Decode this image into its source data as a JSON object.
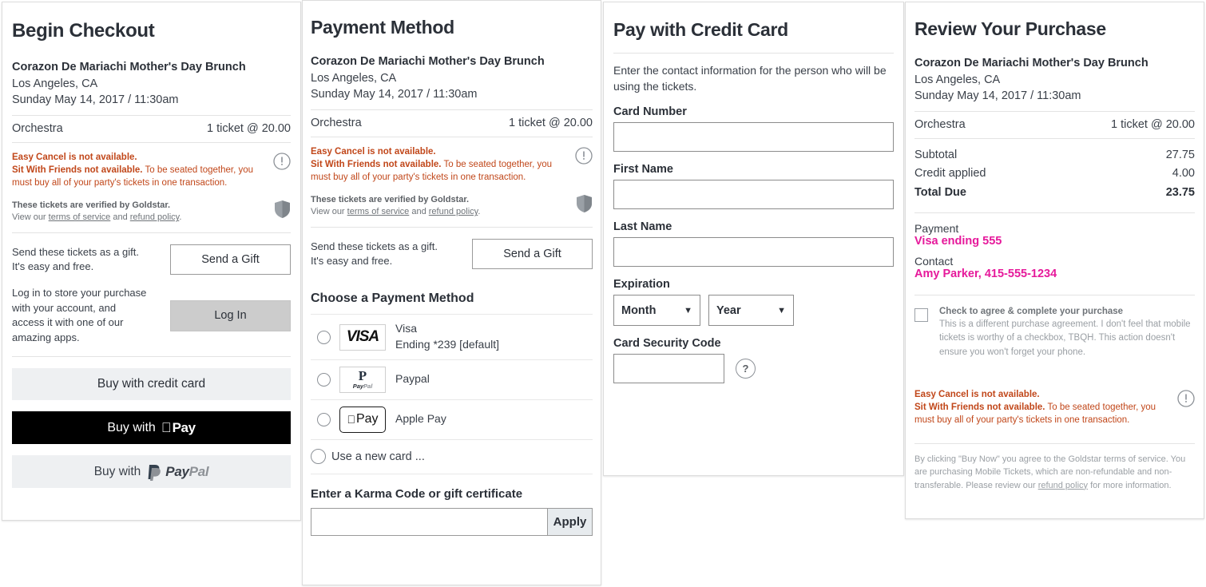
{
  "event": {
    "name": "Corazon De Mariachi Mother's Day Brunch",
    "location": "Los Angeles, CA",
    "datetime": "Sunday May 14, 2017 / 11:30am",
    "section": "Orchestra",
    "quantity_price": "1 ticket @ 20.00"
  },
  "alert": {
    "line1": "Easy Cancel is not available.",
    "line2_bold": "Sit With Friends not available.",
    "line2_rest": " To be seated together, you must buy all of your party's tickets in one transaction.",
    "icon": "warning-icon",
    "color": "#c1471a"
  },
  "verified": {
    "headline": "These tickets are verified by Goldstar.",
    "prefix": "View our ",
    "terms_link": "terms of service",
    "middle": " and ",
    "refund_link": "refund policy",
    "suffix": ".",
    "icon": "shield-icon"
  },
  "panel1": {
    "title": "Begin Checkout",
    "gift_text": "Send these tickets as a gift. It's easy and free.",
    "gift_button": "Send a Gift",
    "login_text": "Log in to store your purchase with your account, and access it with one of our amazing apps.",
    "login_button": "Log In",
    "buy_credit_card": "Buy with credit card",
    "buy_apple_pay_prefix": "Buy with ",
    "buy_apple_pay_word": "Pay",
    "buy_paypal_prefix": "Buy with ",
    "paypal_pay": "Pay",
    "paypal_pal": "Pal"
  },
  "panel2": {
    "title": "Payment Method",
    "gift_text": "Send these tickets as a gift. It's easy and free.",
    "gift_button": "Send a Gift",
    "section_title": "Choose a Payment Method",
    "methods": [
      {
        "logo": "visa-logo",
        "logo_text": "VISA",
        "label_line1": "Visa",
        "label_line2": "Ending *239 [default]",
        "selected": false
      },
      {
        "logo": "paypal-logo",
        "logo_glyph": "P",
        "logo_pay": "Pay",
        "logo_pal": "Pal",
        "label_line1": "Paypal",
        "label_line2": "",
        "selected": false
      },
      {
        "logo": "apple-pay-logo",
        "logo_text": "Pay",
        "label_line1": "Apple Pay",
        "label_line2": "",
        "selected": false
      }
    ],
    "new_card_label": "Use a new card ...",
    "karma_title": "Enter a Karma Code or gift certificate",
    "karma_value": "",
    "karma_placeholder": "",
    "karma_apply": "Apply"
  },
  "panel3": {
    "title": "Pay with Credit Card",
    "intro": "Enter the contact information for the person who will be using the tickets.",
    "card_number_label": "Card Number",
    "card_number_value": "",
    "first_name_label": "First Name",
    "first_name_value": "",
    "last_name_label": "Last Name",
    "last_name_value": "",
    "expiration_label": "Expiration",
    "month_value": "Month",
    "year_value": "Year",
    "csc_label": "Card Security Code",
    "csc_value": "",
    "help_glyph": "?"
  },
  "panel4": {
    "title": "Review Your Purchase",
    "subtotal_label": "Subtotal",
    "subtotal_value": "27.75",
    "credit_label": "Credit applied",
    "credit_value": "4.00",
    "total_label": "Total Due",
    "total_value": "23.75",
    "payment_label": "Payment",
    "payment_value": "Visa ending 555",
    "contact_label": "Contact",
    "contact_value": "Amy Parker, 415-555-1234",
    "agree_title": "Check to agree & complete your purchase",
    "agree_body": "This is a different purchase agreement. I don't feel that mobile tickets is worthy of a checkbox, TBQH. This action doesn't ensure you won't forget your phone.",
    "legal_prefix": "By clicking \"Buy Now\" you agree to the Goldstar terms of service. You are purchasing Mobile Tickets, which are non-refundable and non-transferable.  Please review our ",
    "legal_link": "refund policy",
    "legal_suffix": " for more information.",
    "accent_color": "#e6199b"
  }
}
